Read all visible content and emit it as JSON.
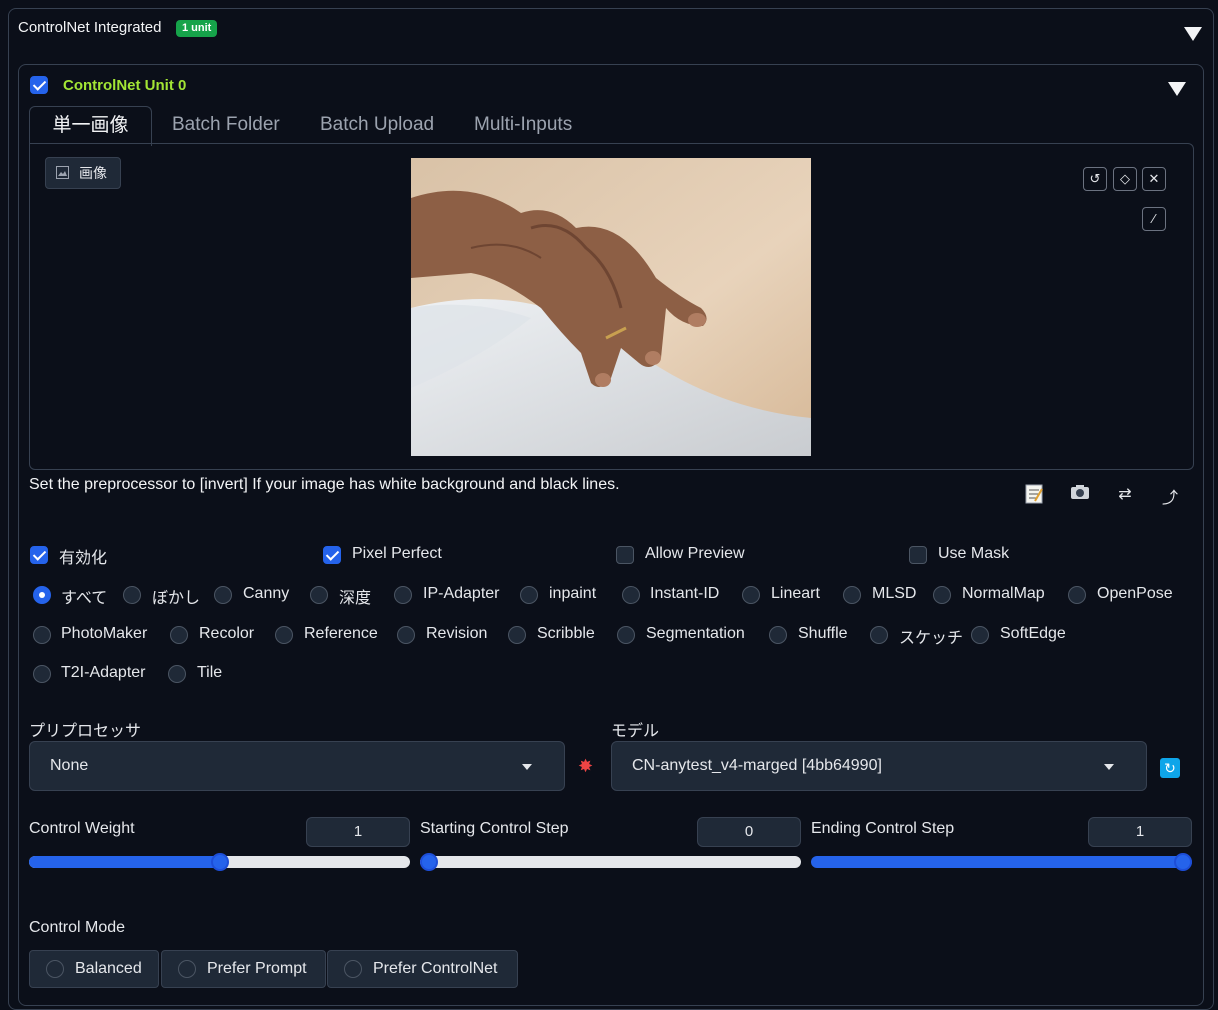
{
  "header": {
    "title": "ControlNet Integrated",
    "badge": "1 unit"
  },
  "unit": {
    "label": "ControlNet Unit 0",
    "tabs": [
      "単一画像",
      "Batch Folder",
      "Batch Upload",
      "Multi-Inputs"
    ],
    "image_label": "画像",
    "photo_description": "photo of a hand",
    "hint": "Set the preprocessor to [invert] If your image has white background and black lines."
  },
  "checkboxes": {
    "enable": {
      "label": "有効化",
      "checked": true
    },
    "pixel_perfect": {
      "label": "Pixel Perfect",
      "checked": true
    },
    "allow_preview": {
      "label": "Allow Preview",
      "checked": false
    },
    "use_mask": {
      "label": "Use Mask",
      "checked": false
    }
  },
  "control_types": {
    "row1": [
      "すべて",
      "ぼかし",
      "Canny",
      "深度",
      "IP-Adapter",
      "inpaint",
      "Instant-ID",
      "Lineart",
      "MLSD",
      "NormalMap",
      "OpenPose"
    ],
    "row2": [
      "PhotoMaker",
      "Recolor",
      "Reference",
      "Revision",
      "Scribble",
      "Segmentation",
      "Shuffle",
      "スケッチ",
      "SoftEdge"
    ],
    "row3": [
      "T2I-Adapter",
      "Tile"
    ],
    "selected": "すべて"
  },
  "preprocessor": {
    "label": "プリプロセッサ",
    "value": "None"
  },
  "model": {
    "label": "モデル",
    "value": "CN-anytest_v4-marged [4bb64990]"
  },
  "sliders": {
    "weight": {
      "label": "Control Weight",
      "value": "1",
      "fraction": 0.5
    },
    "start": {
      "label": "Starting Control Step",
      "value": "0",
      "fraction": 0.0
    },
    "end": {
      "label": "Ending Control Step",
      "value": "1",
      "fraction": 1.0
    }
  },
  "control_mode": {
    "label": "Control Mode",
    "options": [
      "Balanced",
      "Prefer Prompt",
      "Prefer ControlNet"
    ]
  },
  "colors": {
    "accent": "#2563eb",
    "badge": "#16a34a",
    "unit_label": "#a3e635",
    "background": "#0b0f19"
  }
}
